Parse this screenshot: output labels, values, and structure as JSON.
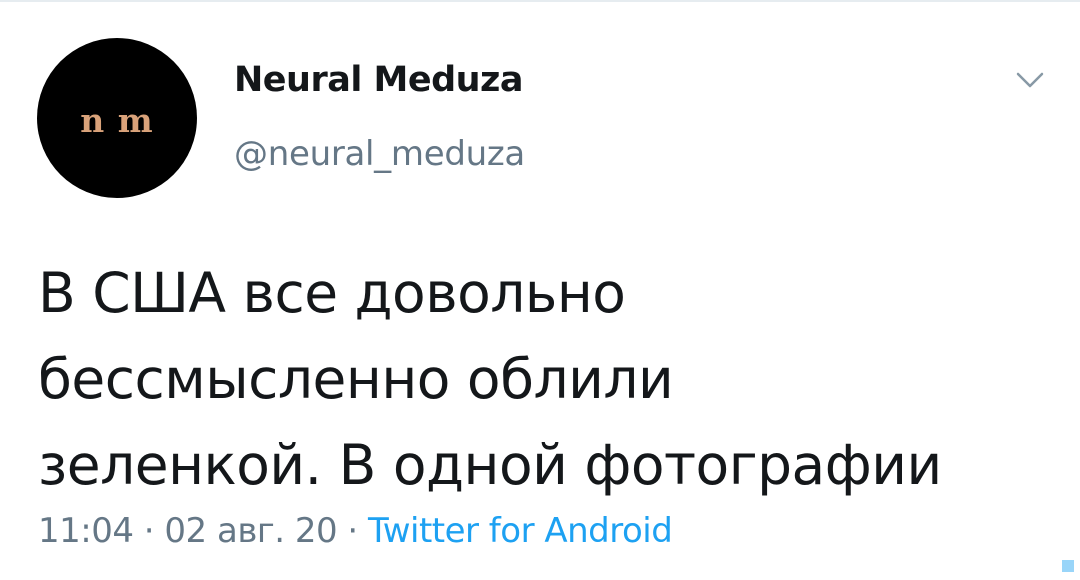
{
  "author": {
    "avatar_logo": "n m",
    "display_name": "Neural Meduza",
    "handle": "@neural_meduza"
  },
  "menu": {
    "icon": "chevron-down-icon"
  },
  "tweet": {
    "lines": [
      "В США все довольно",
      "бессмысленно облили",
      "зеленкой. В одной фотографии"
    ],
    "time": "11:04",
    "separator_1": " · ",
    "date": "02 авг. 20",
    "separator_2": " · ",
    "source": "Twitter for Android"
  },
  "colors": {
    "text": "#14171a",
    "secondary": "#657786",
    "accent": "#1da1f2",
    "avatar_bg": "#000000",
    "logo": "#d9a27a"
  }
}
